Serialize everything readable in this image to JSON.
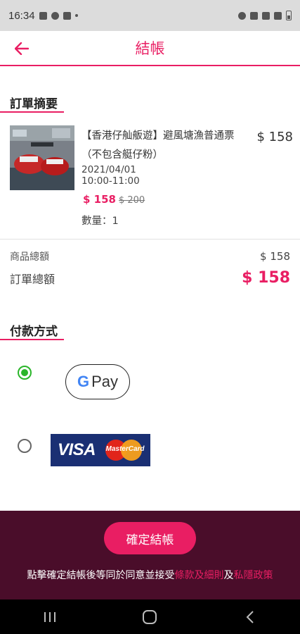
{
  "status_bar": {
    "time": "16:34"
  },
  "header": {
    "title": "結帳"
  },
  "order_summary": {
    "title": "訂單摘要",
    "product": {
      "name": "【香港仔舢舨遊】避風塘漁普通票（不包含艇仔粉）",
      "date": "2021/04/01",
      "time": "10:00-11:00",
      "price": "$ 158",
      "original_price": "$ 200",
      "quantity": "數量：1",
      "line_total": "$ 158"
    },
    "subtotal_label": "商品總額",
    "subtotal_value": "$ 158",
    "total_label": "訂單總額",
    "total_value": "$ 158"
  },
  "payment": {
    "title": "付款方式",
    "options": [
      {
        "name": "Google Pay",
        "selected": true
      },
      {
        "name": "Visa / MasterCard",
        "selected": false
      }
    ],
    "gpay_g": "G",
    "gpay_text": "Pay",
    "visa_text": "VISA",
    "mastercard_text": "MasterCard"
  },
  "footer": {
    "confirm_label": "確定結帳",
    "agree_prefix": "點擊確定結帳後等同於同意並接受",
    "terms_link": "條款及細則",
    "and": "及",
    "privacy_link": "私隱政策"
  },
  "colors": {
    "accent": "#e91e63",
    "footer_bg": "#4a0d2a",
    "radio_selected": "#2ab52a"
  }
}
